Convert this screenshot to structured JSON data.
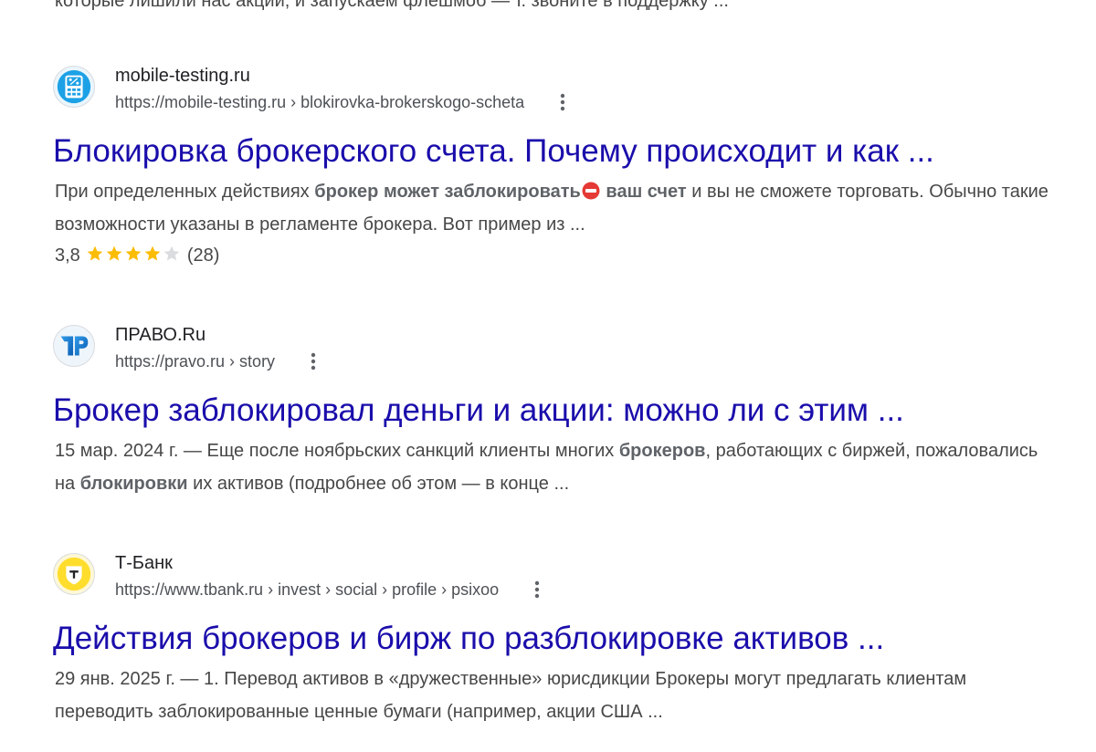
{
  "top_clipped_snippet": "которые лишили нас акций, и запускаем флешмоб — т. звоните в поддержку ...",
  "results": [
    {
      "site_name": "mobile-testing.ru",
      "url": "https://mobile-testing.ru › blokirovka-brokerskogo-scheta",
      "favicon": "calculator-percent-icon",
      "title": "Блокировка брокерского счета. Почему происходит и как ...",
      "snippet": {
        "p1": "При определенных действиях ",
        "b1": "брокер может заблокировать",
        "b2": " ваш счет",
        "p2": " и вы не сможете торговать. Обычно такие возможности указаны в регламенте брокера. Вот пример из ..."
      },
      "rating": {
        "value": "3,8",
        "stars": 3.8,
        "max_stars": 5,
        "count": "(28)"
      }
    },
    {
      "site_name": "ПРАВО.Ru",
      "url": "https://pravo.ru › story",
      "favicon": "pravo-logo-icon",
      "title": "Брокер заблокировал деньги и акции: можно ли с этим ...",
      "snippet": {
        "date": "15 мар. 2024 г.",
        "p1": " — Еще после ноябрьских санкций клиенты многих ",
        "b1": "брокеров",
        "p2": ", работающих с биржей, пожаловались на ",
        "b2": "блокировки",
        "p3": " их активов (подробнее об этом — в конце ..."
      }
    },
    {
      "site_name": "Т-Банк",
      "url": "https://www.tbank.ru › invest › social › profile › psixoo",
      "favicon": "tbank-shield-icon",
      "title": "Действия брокеров и бирж по разблокировке активов ...",
      "snippet": {
        "date": "29 янв. 2025 г.",
        "p1": " — 1. Перевод активов в «дружественные» юрисдикции Брокеры могут предлагать клиентам переводить заблокированные ценные бумаги (например, акции США ..."
      }
    }
  ],
  "colors": {
    "title_link": "#1a0dab",
    "snippet_text": "#474747",
    "star_filled": "#fbbc04",
    "star_empty": "#dadce0",
    "tbank_yellow": "#ffdd2d"
  }
}
